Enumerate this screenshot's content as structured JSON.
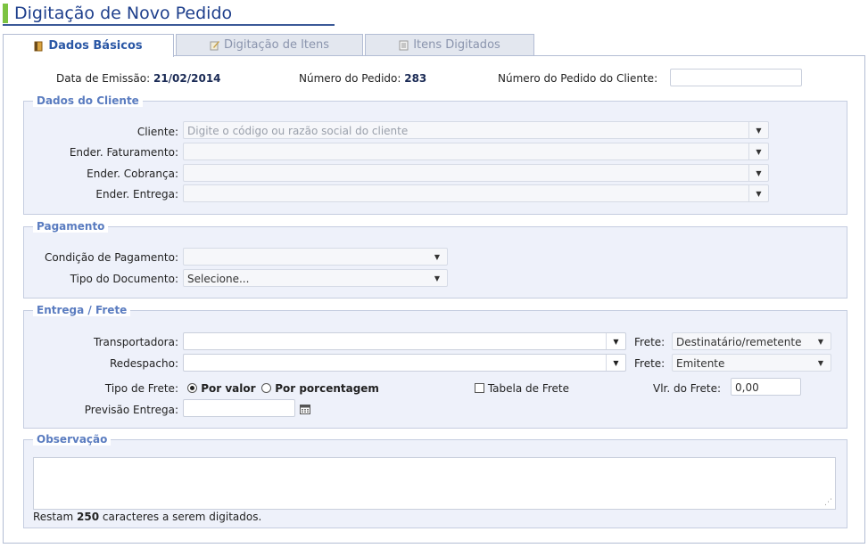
{
  "page": {
    "title": "Digitação de Novo Pedido"
  },
  "tabs": [
    {
      "label": "Dados Básicos",
      "icon": "document-icon",
      "active": true
    },
    {
      "label": "Digitação de Itens",
      "icon": "edit-icon",
      "active": false
    },
    {
      "label": "Itens Digitados",
      "icon": "list-icon",
      "active": false
    }
  ],
  "header_info": {
    "emissao_label": "Data de Emissão:",
    "emissao_value": "21/02/2014",
    "pedido_label": "Número do Pedido:",
    "pedido_value": "283",
    "pedido_cliente_label": "Número do Pedido do Cliente:",
    "pedido_cliente_value": ""
  },
  "cliente": {
    "legend": "Dados do Cliente",
    "cliente_label": "Cliente:",
    "cliente_placeholder": "Digite o código ou razão social do cliente",
    "faturamento_label": "Ender. Faturamento:",
    "cobranca_label": "Ender. Cobrança:",
    "entrega_label": "Ender. Entrega:"
  },
  "pagamento": {
    "legend": "Pagamento",
    "condicao_label": "Condição de Pagamento:",
    "condicao_value": "",
    "tipo_doc_label": "Tipo do Documento:",
    "tipo_doc_value": "Selecione..."
  },
  "entrega": {
    "legend": "Entrega / Frete",
    "transportadora_label": "Transportadora:",
    "redespacho_label": "Redespacho:",
    "frete1_label": "Frete:",
    "frete1_value": "Destinatário/remetente",
    "frete2_label": "Frete:",
    "frete2_value": "Emitente",
    "tipo_frete_label": "Tipo de Frete:",
    "radio_valor": "Por valor",
    "radio_porcentagem": "Por porcentagem",
    "tabela_frete": "Tabela de Frete",
    "vlr_frete_label": "Vlr. do Frete:",
    "vlr_frete_value": "0,00",
    "previsao_label": "Previsão Entrega:"
  },
  "observacao": {
    "legend": "Observação",
    "restam_prefix": "Restam",
    "restam_count": "250",
    "restam_suffix": "caracteres a serem digitados."
  },
  "colors": {
    "title": "#1e3f8c",
    "accent_green": "#7cc341",
    "legend": "#5a7cc0",
    "group_bg": "#eef1fa"
  }
}
